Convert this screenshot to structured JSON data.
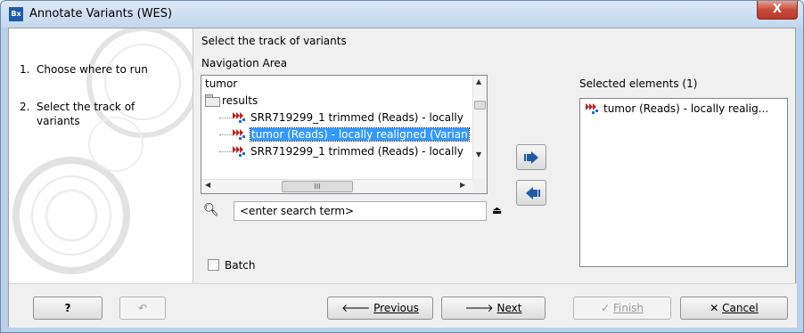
{
  "window": {
    "title": "Annotate Variants (WES)",
    "app_icon_text": "Bx",
    "close_label": "X"
  },
  "steps": [
    {
      "number": "1.",
      "label": "Choose where to run"
    },
    {
      "number": "2.",
      "label": "Select the track of variants"
    }
  ],
  "main": {
    "heading": "Select the track of variants",
    "navigation_label": "Navigation Area",
    "selected_label": "Selected elements (1)",
    "tree": [
      {
        "label": "tumor",
        "type": "text",
        "selected": false
      },
      {
        "label": "results",
        "type": "folder",
        "selected": false
      },
      {
        "label": "SRR719299_1 trimmed (Reads) - locally",
        "type": "variant",
        "selected": false
      },
      {
        "label": "tumor (Reads) - locally realigned (Varian",
        "type": "variant",
        "selected": true
      },
      {
        "label": "SRR719299_1 trimmed (Reads) - locally",
        "type": "variant",
        "selected": false
      }
    ],
    "selected_items": [
      {
        "label": "tumor (Reads) - locally realig..."
      }
    ],
    "search": {
      "placeholder": "<enter search term>"
    },
    "batch_label": "Batch",
    "hscroll_grip": "III"
  },
  "footer": {
    "help_label": "?",
    "previous_label": "Previous",
    "next_label": "Next",
    "finish_label": "Finish",
    "cancel_label": "Cancel"
  },
  "colors": {
    "selection": "#3399ff",
    "variant_icon_red": "#b3261e",
    "variant_icon_blue": "#1f6fd1",
    "arrow_blue": "#1f5aa6"
  }
}
